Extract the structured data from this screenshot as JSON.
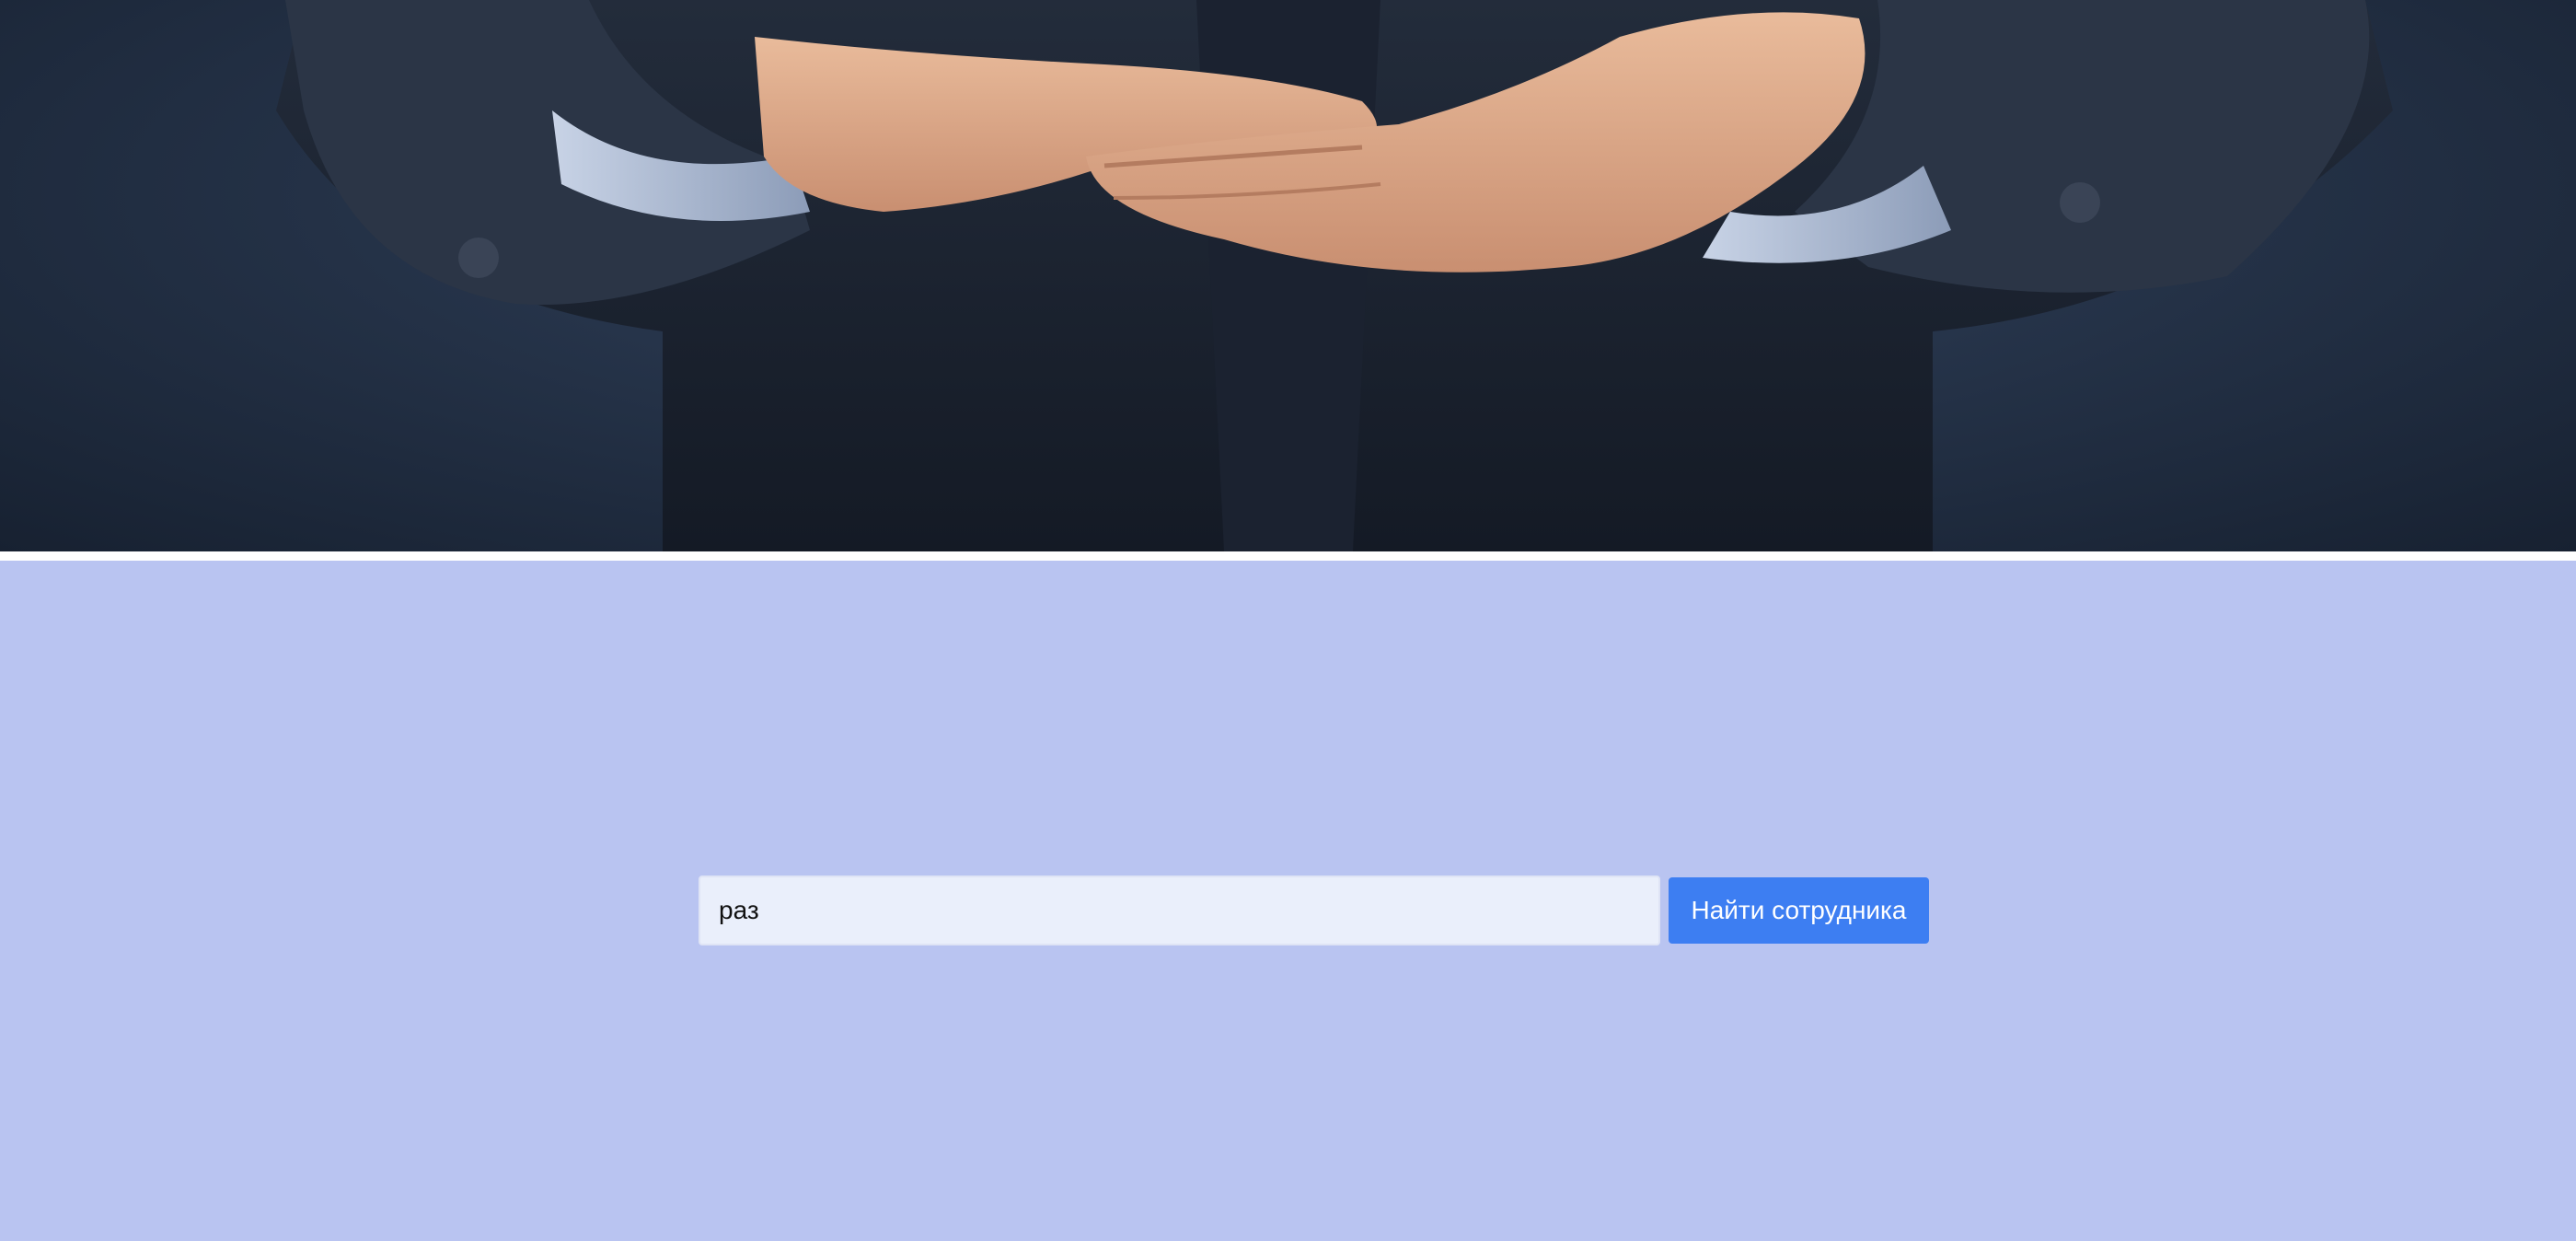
{
  "hero": {
    "image": "businessman-open-hands-photo"
  },
  "search": {
    "query": "раз",
    "button_label": "Найти сотрудника"
  },
  "colors": {
    "section_background": "#b9c4f1",
    "input_background": "#eaeffb",
    "button_background": "#3d7ef2",
    "button_text": "#ffffff"
  }
}
